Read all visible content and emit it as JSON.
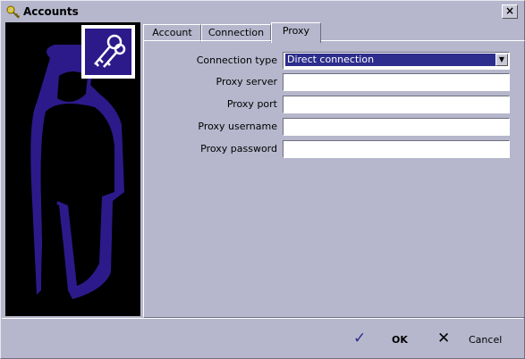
{
  "window": {
    "title": "Accounts",
    "close_label": "×"
  },
  "tabs": [
    {
      "label": "Account",
      "active": false
    },
    {
      "label": "Connection",
      "active": false
    },
    {
      "label": "Proxy",
      "active": true
    }
  ],
  "form": {
    "connection_type_label": "Connection type",
    "connection_type_value": "Direct connection",
    "proxy_server_label": "Proxy server",
    "proxy_server_value": "",
    "proxy_port_label": "Proxy port",
    "proxy_port_value": "",
    "proxy_username_label": "Proxy username",
    "proxy_username_value": "",
    "proxy_password_label": "Proxy password",
    "proxy_password_value": ""
  },
  "buttons": {
    "ok_label": "OK",
    "cancel_label": "Cancel"
  },
  "icons": {
    "title": "key-icon",
    "left_panel": "person-with-keys-icon",
    "ok": "check-icon",
    "cancel": "x-icon",
    "dropdown": "dropdown-arrow-icon"
  },
  "colors": {
    "background": "#b6b7cc",
    "silhouette": "#2c1a8a",
    "selection": "#2c2d8c"
  }
}
